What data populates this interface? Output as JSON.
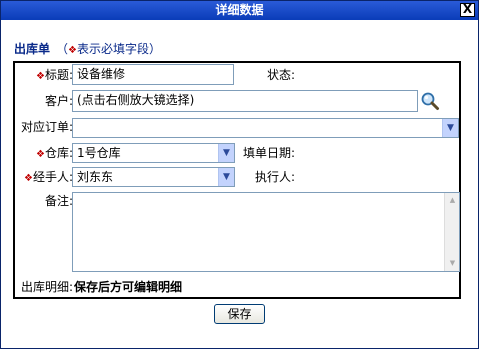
{
  "window": {
    "title": "详细数据",
    "close_label": "X"
  },
  "section": {
    "title": "出库单",
    "note_prefix": "（",
    "required_mark": "❖",
    "note_text": "表示必填字段",
    "note_suffix": "）"
  },
  "form": {
    "title_label": "标题:",
    "title_value": "设备维修",
    "status_label": "状态:",
    "customer_label": "客户:",
    "customer_value": "(点击右侧放大镜选择)",
    "order_label": "对应订单:",
    "order_value": "",
    "warehouse_label": "仓库:",
    "warehouse_value": "1号仓库",
    "fill_date_label": "填单日期:",
    "handler_label": "经手人:",
    "handler_value": "刘东东",
    "executor_label": "执行人:",
    "remark_label": "备注:",
    "detail_label": "出库明细:",
    "detail_note": "保存后方可编辑明细"
  },
  "actions": {
    "save_label": "保存"
  }
}
